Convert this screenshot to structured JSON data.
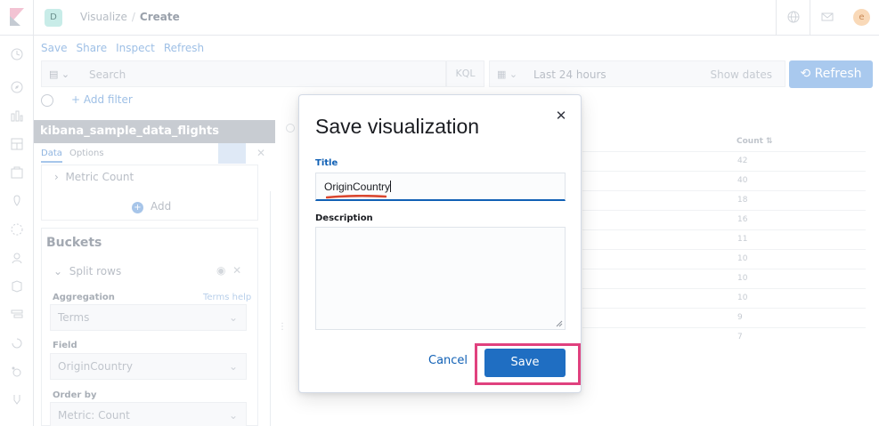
{
  "header": {
    "space_initial": "D",
    "breadcrumb": [
      "Visualize",
      "Create"
    ],
    "user_initial": "e"
  },
  "menu": [
    "Save",
    "Share",
    "Inspect",
    "Refresh"
  ],
  "query": {
    "placeholder": "Search",
    "language": "KQL",
    "time_range": "Last 24 hours",
    "show_dates": "Show dates",
    "refresh_label": "Refresh"
  },
  "filter": {
    "add_label": "+ Add filter"
  },
  "editor": {
    "index_pattern": "kibana_sample_data_flights",
    "tabs": [
      "Data",
      "Options"
    ],
    "metric_label": "Metric Count",
    "add_label": "Add",
    "buckets_title": "Buckets",
    "split_rows": "Split rows",
    "aggregation_label": "Aggregation",
    "aggregation_help": "Terms help",
    "aggregation_value": "Terms",
    "field_label": "Field",
    "field_value": "OriginCountry",
    "order_label": "Order by",
    "order_value": "Metric: Count"
  },
  "table": {
    "header": "Count",
    "counts": [
      "42",
      "40",
      "18",
      "16",
      "11",
      "10",
      "10",
      "10",
      "9",
      "7"
    ]
  },
  "modal": {
    "title": "Save visualization",
    "title_label": "Title",
    "title_value": "OriginCountry",
    "description_label": "Description",
    "description_value": "",
    "cancel_label": "Cancel",
    "save_label": "Save",
    "highlight_color": "#e0417e",
    "accent_color": "#1060b5"
  }
}
